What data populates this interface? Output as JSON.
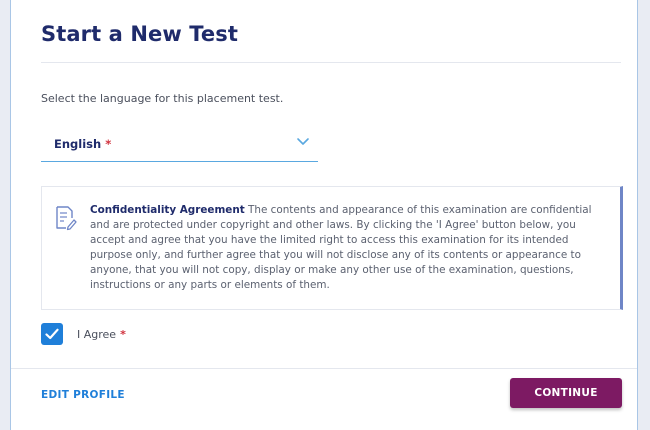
{
  "dialog": {
    "title": "Start a New Test",
    "instruction": "Select the language for this placement test."
  },
  "language_select": {
    "selected": "English",
    "required_mark": "*",
    "icon": "chevron-down-icon"
  },
  "agreement": {
    "icon": "document-edit-icon",
    "title": "Confidentiality Agreement",
    "body": "The contents and appearance of this examination are confidential and are protected under copyright and other laws. By clicking the 'I Agree' button below, you accept and agree that you have the limited right to access this examination for its intended purpose only, and further agree that you will not disclose any of its contents or appearance to anyone, that you will not copy, display or make any other use of the examination, questions, instructions or any parts or elements of them."
  },
  "agree_checkbox": {
    "label": "I Agree",
    "required_mark": "*",
    "checked": true
  },
  "footer": {
    "edit_profile_label": "EDIT PROFILE",
    "continue_label": "CONTINUE"
  },
  "colors": {
    "title": "#1f2b6b",
    "accent_blue": "#1f7fd9",
    "continue_button": "#7d1a63",
    "required": "#d0313d"
  }
}
